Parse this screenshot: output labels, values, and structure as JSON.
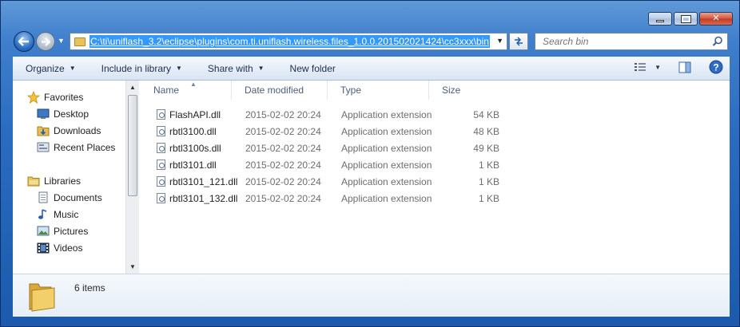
{
  "window": {
    "colors": {
      "frame": "#2a6cc0",
      "selection": "#3399ff",
      "content_bg": "#ffffff"
    }
  },
  "address_bar": {
    "path": "C:\\ti\\uniflash_3.2\\eclipse\\plugins\\com.ti.uniflash.wireless.files_1.0.0.201502021424\\cc3xxx\\bin"
  },
  "search": {
    "placeholder": "Search bin"
  },
  "toolbar": {
    "organize": "Organize",
    "include_in_library": "Include in library",
    "share_with": "Share with",
    "new_folder": "New folder"
  },
  "nav_pane": {
    "favorites": {
      "label": "Favorites",
      "items": [
        {
          "label": "Desktop",
          "icon": "desktop-icon"
        },
        {
          "label": "Downloads",
          "icon": "downloads-icon"
        },
        {
          "label": "Recent Places",
          "icon": "recent-places-icon"
        }
      ]
    },
    "libraries": {
      "label": "Libraries",
      "items": [
        {
          "label": "Documents",
          "icon": "documents-icon"
        },
        {
          "label": "Music",
          "icon": "music-icon"
        },
        {
          "label": "Pictures",
          "icon": "pictures-icon"
        },
        {
          "label": "Videos",
          "icon": "videos-icon"
        }
      ]
    }
  },
  "columns": {
    "name": "Name",
    "date": "Date modified",
    "type": "Type",
    "size": "Size"
  },
  "files": [
    {
      "name": "FlashAPI.dll",
      "date": "2015-02-02 20:24",
      "type": "Application extension",
      "size": "54 KB"
    },
    {
      "name": "rbtl3100.dll",
      "date": "2015-02-02 20:24",
      "type": "Application extension",
      "size": "48 KB"
    },
    {
      "name": "rbtl3100s.dll",
      "date": "2015-02-02 20:24",
      "type": "Application extension",
      "size": "49 KB"
    },
    {
      "name": "rbtl3101.dll",
      "date": "2015-02-02 20:24",
      "type": "Application extension",
      "size": "1 KB"
    },
    {
      "name": "rbtl3101_121.dll",
      "date": "2015-02-02 20:24",
      "type": "Application extension",
      "size": "1 KB"
    },
    {
      "name": "rbtl3101_132.dll",
      "date": "2015-02-02 20:24",
      "type": "Application extension",
      "size": "1 KB"
    }
  ],
  "details": {
    "item_count": "6 items"
  }
}
